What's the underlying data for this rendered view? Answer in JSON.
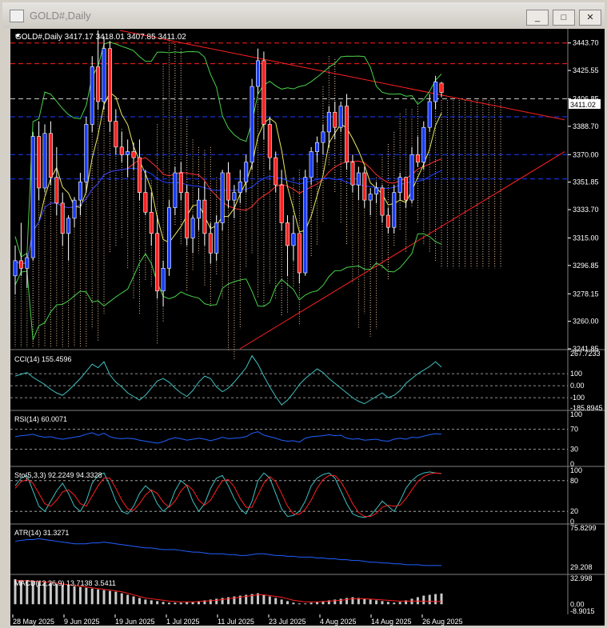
{
  "window": {
    "title": "GOLD#,Daily",
    "buttons": {
      "minimize": "_",
      "maximize": "□",
      "close": "✕"
    }
  },
  "main": {
    "header": "GOLD#,Daily  3417.17 3418.01 3407.85 3411.02",
    "symbol": "GOLD#,Daily",
    "ohlc": "3417.17 3418.01 3407.85 3411.02",
    "price_labels": [
      "3443.70",
      "3425.55",
      "3406.85",
      "3388.70",
      "3370.00",
      "3351.85",
      "3333.70",
      "3315.00",
      "3296.85",
      "3278.15",
      "3260.00",
      "3241.85"
    ],
    "current_price": "3411.02",
    "colors": {
      "bull": "#1a3cff",
      "bear": "#ff2020",
      "ichimoku_cloud": "#f0c8a0",
      "trendline": "#ff2020",
      "bollinger": "#4ad04a"
    }
  },
  "indicators": [
    {
      "label": "CCI(14) 155.4596",
      "scale": [
        "267.7233",
        "100",
        "0.00",
        "-100",
        "-185.8945"
      ]
    },
    {
      "label": "RSI(14) 60.0071",
      "scale": [
        "100",
        "70",
        "30",
        "0"
      ]
    },
    {
      "label": "Sto(5,3,3) 92.2249 94.3328",
      "scale": [
        "100",
        "80",
        "20",
        "0"
      ]
    },
    {
      "label": "ATR(14) 31.3271",
      "scale": [
        "75.8299",
        "29.208"
      ]
    },
    {
      "label": "MACD(12,26,9) 13.7138 3.5411",
      "scale": [
        "32.998",
        "0.00",
        "-8.9015"
      ]
    }
  ],
  "dates": [
    "28 May 2025",
    "9 Jun 2025",
    "19 Jun 2025",
    "1 Jul 2025",
    "11 Jul 2025",
    "23 Jul 2025",
    "4 Aug 2025",
    "14 Aug 2025",
    "26 Aug 2025"
  ],
  "chart_data": {
    "type": "candlestick",
    "candles": [
      [
        3290,
        3310,
        3278,
        3300
      ],
      [
        3300,
        3325,
        3290,
        3295
      ],
      [
        3295,
        3305,
        3282,
        3302
      ],
      [
        3302,
        3385,
        3300,
        3382
      ],
      [
        3382,
        3392,
        3340,
        3348
      ],
      [
        3348,
        3390,
        3345,
        3384
      ],
      [
        3384,
        3392,
        3350,
        3355
      ],
      [
        3355,
        3375,
        3330,
        3338
      ],
      [
        3338,
        3345,
        3310,
        3318
      ],
      [
        3318,
        3330,
        3300,
        3328
      ],
      [
        3328,
        3342,
        3322,
        3340
      ],
      [
        3340,
        3358,
        3330,
        3352
      ],
      [
        3352,
        3395,
        3345,
        3390
      ],
      [
        3390,
        3435,
        3385,
        3428
      ],
      [
        3428,
        3452,
        3400,
        3405
      ],
      [
        3405,
        3448,
        3400,
        3440
      ],
      [
        3440,
        3445,
        3385,
        3392
      ],
      [
        3392,
        3400,
        3370,
        3375
      ],
      [
        3375,
        3385,
        3365,
        3370
      ],
      [
        3370,
        3380,
        3355,
        3372
      ],
      [
        3372,
        3378,
        3360,
        3368
      ],
      [
        3368,
        3380,
        3340,
        3345
      ],
      [
        3345,
        3360,
        3330,
        3332
      ],
      [
        3332,
        3345,
        3310,
        3318
      ],
      [
        3318,
        3330,
        3275,
        3280
      ],
      [
        3280,
        3300,
        3270,
        3295
      ],
      [
        3295,
        3340,
        3290,
        3335
      ],
      [
        3335,
        3362,
        3330,
        3358
      ],
      [
        3358,
        3365,
        3340,
        3345
      ],
      [
        3345,
        3350,
        3310,
        3315
      ],
      [
        3315,
        3330,
        3305,
        3328
      ],
      [
        3328,
        3348,
        3320,
        3340
      ],
      [
        3340,
        3352,
        3310,
        3318
      ],
      [
        3318,
        3325,
        3298,
        3305
      ],
      [
        3305,
        3330,
        3300,
        3325
      ],
      [
        3325,
        3360,
        3320,
        3358
      ],
      [
        3358,
        3365,
        3335,
        3340
      ],
      [
        3340,
        3350,
        3328,
        3345
      ],
      [
        3345,
        3360,
        3338,
        3352
      ],
      [
        3352,
        3370,
        3345,
        3365
      ],
      [
        3365,
        3420,
        3360,
        3415
      ],
      [
        3415,
        3440,
        3410,
        3432
      ],
      [
        3432,
        3438,
        3380,
        3390
      ],
      [
        3390,
        3395,
        3360,
        3368
      ],
      [
        3368,
        3372,
        3345,
        3350
      ],
      [
        3350,
        3360,
        3320,
        3325
      ],
      [
        3325,
        3330,
        3290,
        3310
      ],
      [
        3310,
        3330,
        3300,
        3318
      ],
      [
        3318,
        3315,
        3285,
        3292
      ],
      [
        3292,
        3360,
        3290,
        3355
      ],
      [
        3355,
        3375,
        3350,
        3372
      ],
      [
        3372,
        3382,
        3365,
        3378
      ],
      [
        3378,
        3390,
        3370,
        3385
      ],
      [
        3385,
        3402,
        3375,
        3398
      ],
      [
        3398,
        3405,
        3380,
        3388
      ],
      [
        3388,
        3405,
        3385,
        3402
      ],
      [
        3402,
        3410,
        3360,
        3365
      ],
      [
        3365,
        3370,
        3345,
        3350
      ],
      [
        3350,
        3362,
        3340,
        3358
      ],
      [
        3358,
        3362,
        3335,
        3340
      ],
      [
        3340,
        3348,
        3330,
        3344
      ],
      [
        3344,
        3352,
        3338,
        3348
      ],
      [
        3348,
        3350,
        3325,
        3330
      ],
      [
        3330,
        3335,
        3318,
        3322
      ],
      [
        3322,
        3350,
        3318,
        3345
      ],
      [
        3345,
        3358,
        3340,
        3355
      ],
      [
        3355,
        3352,
        3335,
        3340
      ],
      [
        3340,
        3375,
        3338,
        3370
      ],
      [
        3370,
        3382,
        3362,
        3365
      ],
      [
        3365,
        3392,
        3360,
        3388
      ],
      [
        3388,
        3410,
        3385,
        3405
      ],
      [
        3405,
        3422,
        3400,
        3418
      ],
      [
        3417.17,
        3418.01,
        3407.85,
        3411.02
      ]
    ],
    "y_range": [
      3241.85,
      3452
    ],
    "x_tick_labels": [
      "28 May 2025",
      "9 Jun 2025",
      "19 Jun 2025",
      "1 Jul 2025",
      "11 Jul 2025",
      "23 Jul 2025",
      "4 Aug 2025",
      "14 Aug 2025",
      "26 Aug 2025"
    ],
    "horizontal_levels": [
      {
        "value": 3443.7,
        "color": "#ff2020",
        "style": "dash"
      },
      {
        "value": 3430,
        "color": "#ff2020",
        "style": "dash"
      },
      {
        "value": 3406.85,
        "color": "#c8c8c8",
        "style": "dash"
      },
      {
        "value": 3395,
        "color": "#1a3cff",
        "style": "dash"
      },
      {
        "value": 3370,
        "color": "#1a3cff",
        "style": "dash"
      },
      {
        "value": 3354,
        "color": "#1a3cff",
        "style": "dash"
      }
    ],
    "cci": [
      80,
      95,
      110,
      70,
      40,
      10,
      -30,
      -60,
      -80,
      -40,
      10,
      60,
      120,
      180,
      150,
      200,
      90,
      30,
      -10,
      -60,
      -90,
      -120,
      -80,
      -20,
      40,
      60,
      30,
      -20,
      -60,
      -90,
      -40,
      30,
      80,
      60,
      -10,
      -50,
      -20,
      30,
      90,
      150,
      250,
      180,
      80,
      -10,
      -90,
      -160,
      -120,
      -60,
      10,
      60,
      100,
      140,
      110,
      60,
      20,
      -20,
      -60,
      -100,
      -130,
      -150,
      -120,
      -90,
      -60,
      -100,
      -80,
      -40,
      20,
      60,
      100,
      130,
      160,
      200,
      155
    ],
    "rsi": [
      55,
      57,
      58,
      60,
      56,
      54,
      55,
      52,
      50,
      52,
      54,
      56,
      60,
      63,
      58,
      62,
      55,
      52,
      51,
      52,
      51,
      48,
      46,
      44,
      42,
      45,
      50,
      53,
      51,
      48,
      50,
      52,
      50,
      47,
      50,
      54,
      51,
      52,
      53,
      55,
      62,
      65,
      58,
      55,
      52,
      48,
      46,
      47,
      44,
      52,
      55,
      56,
      57,
      59,
      57,
      58,
      52,
      50,
      51,
      48,
      49,
      50,
      47,
      46,
      50,
      52,
      50,
      54,
      53,
      56,
      59,
      61,
      60
    ],
    "stoch_k": [
      70,
      85,
      90,
      60,
      30,
      20,
      40,
      60,
      75,
      55,
      30,
      20,
      40,
      75,
      90,
      95,
      70,
      40,
      20,
      15,
      30,
      55,
      70,
      60,
      35,
      20,
      30,
      60,
      80,
      70,
      40,
      20,
      35,
      65,
      85,
      90,
      70,
      45,
      25,
      15,
      40,
      80,
      95,
      85,
      55,
      25,
      10,
      12,
      20,
      40,
      70,
      85,
      92,
      95,
      85,
      60,
      35,
      15,
      10,
      8,
      12,
      25,
      40,
      30,
      20,
      40,
      65,
      80,
      90,
      95,
      97,
      95,
      94
    ],
    "stoch_d": [
      65,
      78,
      82,
      75,
      55,
      35,
      30,
      42,
      58,
      62,
      52,
      35,
      30,
      50,
      70,
      85,
      85,
      65,
      42,
      25,
      22,
      35,
      52,
      62,
      55,
      38,
      28,
      40,
      60,
      72,
      62,
      42,
      32,
      42,
      62,
      80,
      82,
      68,
      45,
      28,
      28,
      52,
      75,
      88,
      78,
      55,
      30,
      15,
      14,
      24,
      42,
      65,
      82,
      90,
      90,
      78,
      58,
      35,
      18,
      10,
      10,
      16,
      28,
      32,
      30,
      32,
      45,
      62,
      78,
      88,
      93,
      95,
      94
    ],
    "atr": [
      60,
      61,
      62,
      62,
      63,
      62,
      61,
      60,
      59,
      58,
      57,
      57,
      57,
      58,
      58,
      59,
      58,
      57,
      56,
      55,
      54,
      53,
      52,
      52,
      51,
      50,
      50,
      50,
      49,
      48,
      47,
      47,
      46,
      45,
      45,
      45,
      44,
      44,
      43,
      43,
      44,
      45,
      45,
      44,
      43,
      43,
      42,
      42,
      41,
      41,
      41,
      40,
      40,
      39,
      39,
      38,
      38,
      37,
      37,
      36,
      35,
      35,
      34,
      34,
      33,
      33,
      32,
      32,
      32,
      31,
      31,
      31,
      31
    ],
    "macd_hist": [
      32,
      31,
      31,
      30,
      29,
      28,
      27,
      26,
      25,
      24,
      23,
      22,
      21,
      20,
      19,
      18,
      17,
      16,
      14,
      12,
      10,
      8,
      6,
      5,
      4,
      3,
      2,
      2,
      2,
      3,
      3,
      4,
      5,
      6,
      7,
      8,
      9,
      10,
      11,
      12,
      13,
      14,
      12,
      10,
      8,
      6,
      4,
      2,
      1,
      1,
      2,
      3,
      4,
      5,
      6,
      7,
      8,
      9,
      8,
      7,
      6,
      5,
      4,
      3,
      2,
      3,
      5,
      7,
      9,
      11,
      12,
      13,
      13.7138
    ],
    "macd_signal": [
      30,
      30,
      30,
      29.5,
      29,
      28.5,
      28,
      27,
      26,
      25,
      24,
      23,
      22,
      21,
      20,
      19,
      18,
      17,
      16,
      14,
      12,
      10,
      8,
      7,
      6,
      5,
      4,
      3.5,
      3,
      3,
      3,
      3.5,
      4,
      4.5,
      5,
      6,
      7,
      8,
      9,
      10,
      11,
      12,
      12,
      11,
      10,
      9,
      7,
      5,
      4,
      3,
      3,
      3,
      3.5,
      4,
      4.5,
      5,
      6,
      7,
      7,
      7,
      6.5,
      6,
      5.5,
      5,
      4.5,
      4,
      4,
      4,
      4,
      3.8,
      3.6,
      3.5,
      3.5411
    ]
  }
}
